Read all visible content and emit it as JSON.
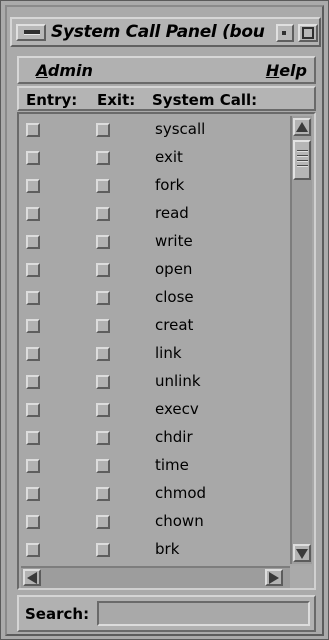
{
  "window": {
    "title": "System Call Panel (bou",
    "menus": [
      "Admin",
      "Help"
    ]
  },
  "columns": {
    "entry": "Entry:",
    "exit": "Exit:",
    "name": "System Call:"
  },
  "syscalls": [
    {
      "name": "syscall",
      "entry": false,
      "exit": false
    },
    {
      "name": "exit",
      "entry": false,
      "exit": false
    },
    {
      "name": "fork",
      "entry": false,
      "exit": false
    },
    {
      "name": "read",
      "entry": false,
      "exit": false
    },
    {
      "name": "write",
      "entry": false,
      "exit": false
    },
    {
      "name": "open",
      "entry": false,
      "exit": false
    },
    {
      "name": "close",
      "entry": false,
      "exit": false
    },
    {
      "name": "creat",
      "entry": false,
      "exit": false
    },
    {
      "name": "link",
      "entry": false,
      "exit": false
    },
    {
      "name": "unlink",
      "entry": false,
      "exit": false
    },
    {
      "name": "execv",
      "entry": false,
      "exit": false
    },
    {
      "name": "chdir",
      "entry": false,
      "exit": false
    },
    {
      "name": "time",
      "entry": false,
      "exit": false
    },
    {
      "name": "chmod",
      "entry": false,
      "exit": false
    },
    {
      "name": "chown",
      "entry": false,
      "exit": false
    },
    {
      "name": "brk",
      "entry": false,
      "exit": false
    }
  ],
  "search": {
    "label": "Search:",
    "value": ""
  },
  "icons": {
    "window_menu": "window-menu-icon",
    "minimize": "minimize-icon",
    "maximize": "maximize-icon",
    "scroll_up": "arrow-up-icon",
    "scroll_down": "arrow-down-icon",
    "scroll_left": "arrow-left-icon",
    "scroll_right": "arrow-right-icon"
  },
  "colors": {
    "background": "#aaaaaa",
    "text": "#000000"
  }
}
